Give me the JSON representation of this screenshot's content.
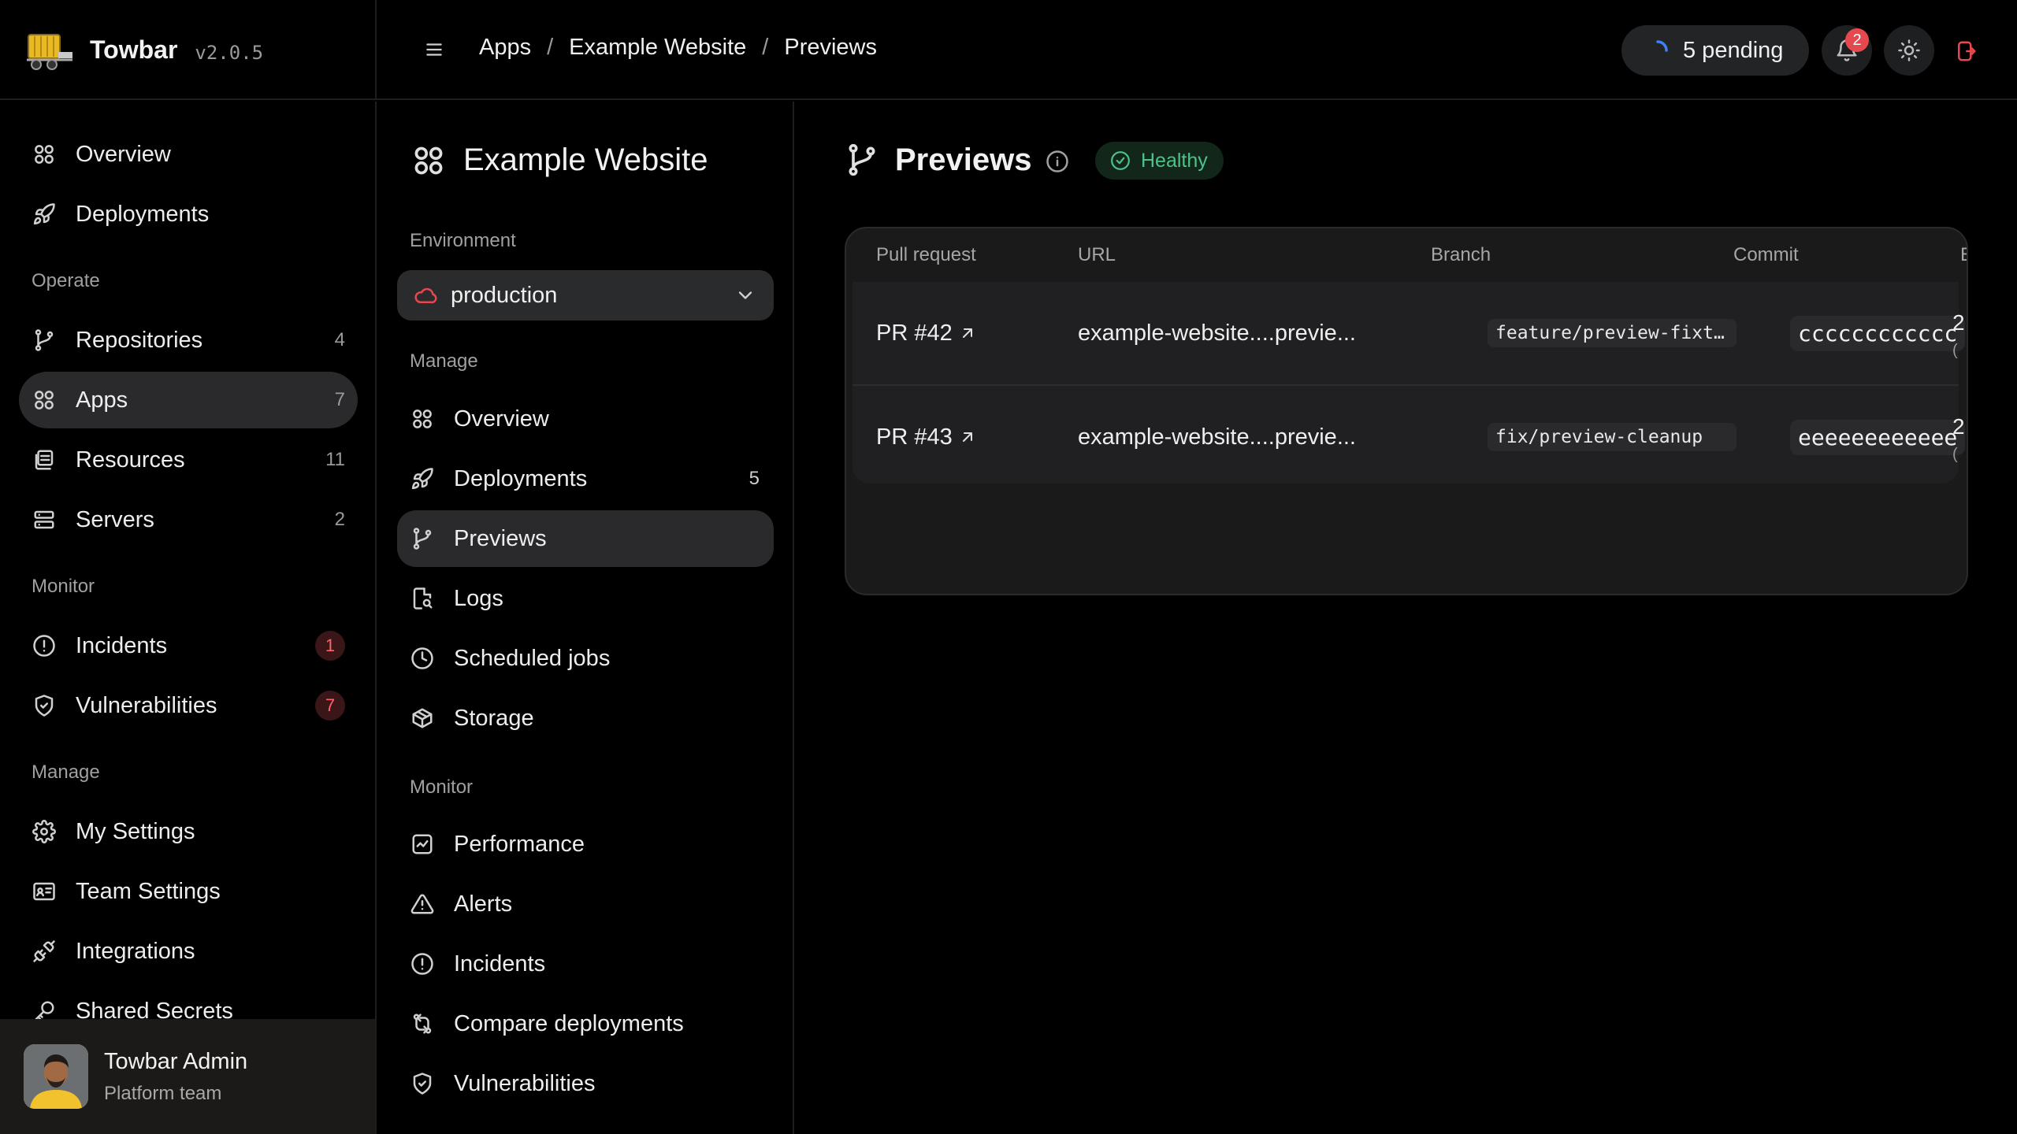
{
  "brand": {
    "name": "Towbar",
    "version": "v2.0.5"
  },
  "breadcrumb": [
    "Apps",
    "Example Website",
    "Previews"
  ],
  "header": {
    "pending_label": "5 pending",
    "notification_count": "2"
  },
  "sidebar": {
    "top_items": [
      {
        "label": "Overview",
        "icon": "grid-icon"
      },
      {
        "label": "Deployments",
        "icon": "rocket-icon"
      }
    ],
    "operate_label": "Operate",
    "operate_items": [
      {
        "label": "Repositories",
        "count": "4",
        "icon": "git-branch-icon"
      },
      {
        "label": "Apps",
        "count": "7",
        "icon": "grid-icon",
        "active": true
      },
      {
        "label": "Resources",
        "count": "11",
        "icon": "database-icon"
      },
      {
        "label": "Servers",
        "count": "2",
        "icon": "server-icon"
      }
    ],
    "monitor_label": "Monitor",
    "monitor_items": [
      {
        "label": "Incidents",
        "badge": "1",
        "icon": "alert-circle-icon"
      },
      {
        "label": "Vulnerabilities",
        "badge": "7",
        "icon": "shield-icon"
      }
    ],
    "manage_label": "Manage",
    "manage_items": [
      {
        "label": "My Settings",
        "icon": "gear-icon"
      },
      {
        "label": "Team Settings",
        "icon": "id-card-icon"
      },
      {
        "label": "Integrations",
        "icon": "plug-icon"
      },
      {
        "label": "Shared Secrets",
        "icon": "key-icon"
      }
    ],
    "user": {
      "name": "Towbar Admin",
      "team": "Platform team"
    }
  },
  "app": {
    "title": "Example Website",
    "environment_label": "Environment",
    "environment_value": "production",
    "manage_label": "Manage",
    "manage_items": [
      {
        "label": "Overview",
        "icon": "grid-icon"
      },
      {
        "label": "Deployments",
        "count": "5",
        "icon": "rocket-icon"
      },
      {
        "label": "Previews",
        "icon": "git-branch-icon",
        "active": true
      },
      {
        "label": "Logs",
        "icon": "file-search-icon"
      },
      {
        "label": "Scheduled jobs",
        "icon": "clock-icon"
      },
      {
        "label": "Storage",
        "icon": "box-icon"
      }
    ],
    "monitor_label": "Monitor",
    "monitor_items": [
      {
        "label": "Performance",
        "icon": "activity-icon"
      },
      {
        "label": "Alerts",
        "icon": "warning-icon"
      },
      {
        "label": "Incidents",
        "icon": "alert-circle-icon"
      },
      {
        "label": "Compare deployments",
        "icon": "compare-icon"
      },
      {
        "label": "Vulnerabilities",
        "icon": "shield-icon"
      }
    ]
  },
  "main": {
    "title": "Previews",
    "status": "Healthy",
    "status_color": "#4cc38a",
    "columns": [
      "Pull request",
      "URL",
      "Branch",
      "Commit",
      "E"
    ],
    "rows": [
      {
        "pr": "PR #42",
        "url": "example-website....previe...",
        "branch": "feature/preview-fixt…",
        "commit": "cccccccccccc",
        "extra_top": "2",
        "extra_bottom": "("
      },
      {
        "pr": "PR #43",
        "url": "example-website....previe...",
        "branch": "fix/preview-cleanup",
        "commit": "eeeeeeeeeeee",
        "extra_top": "2",
        "extra_bottom": "("
      }
    ]
  },
  "colors": {
    "accent_red": "#e5484d",
    "healthy": "#4cc38a",
    "spinner": "#3b82f6"
  }
}
